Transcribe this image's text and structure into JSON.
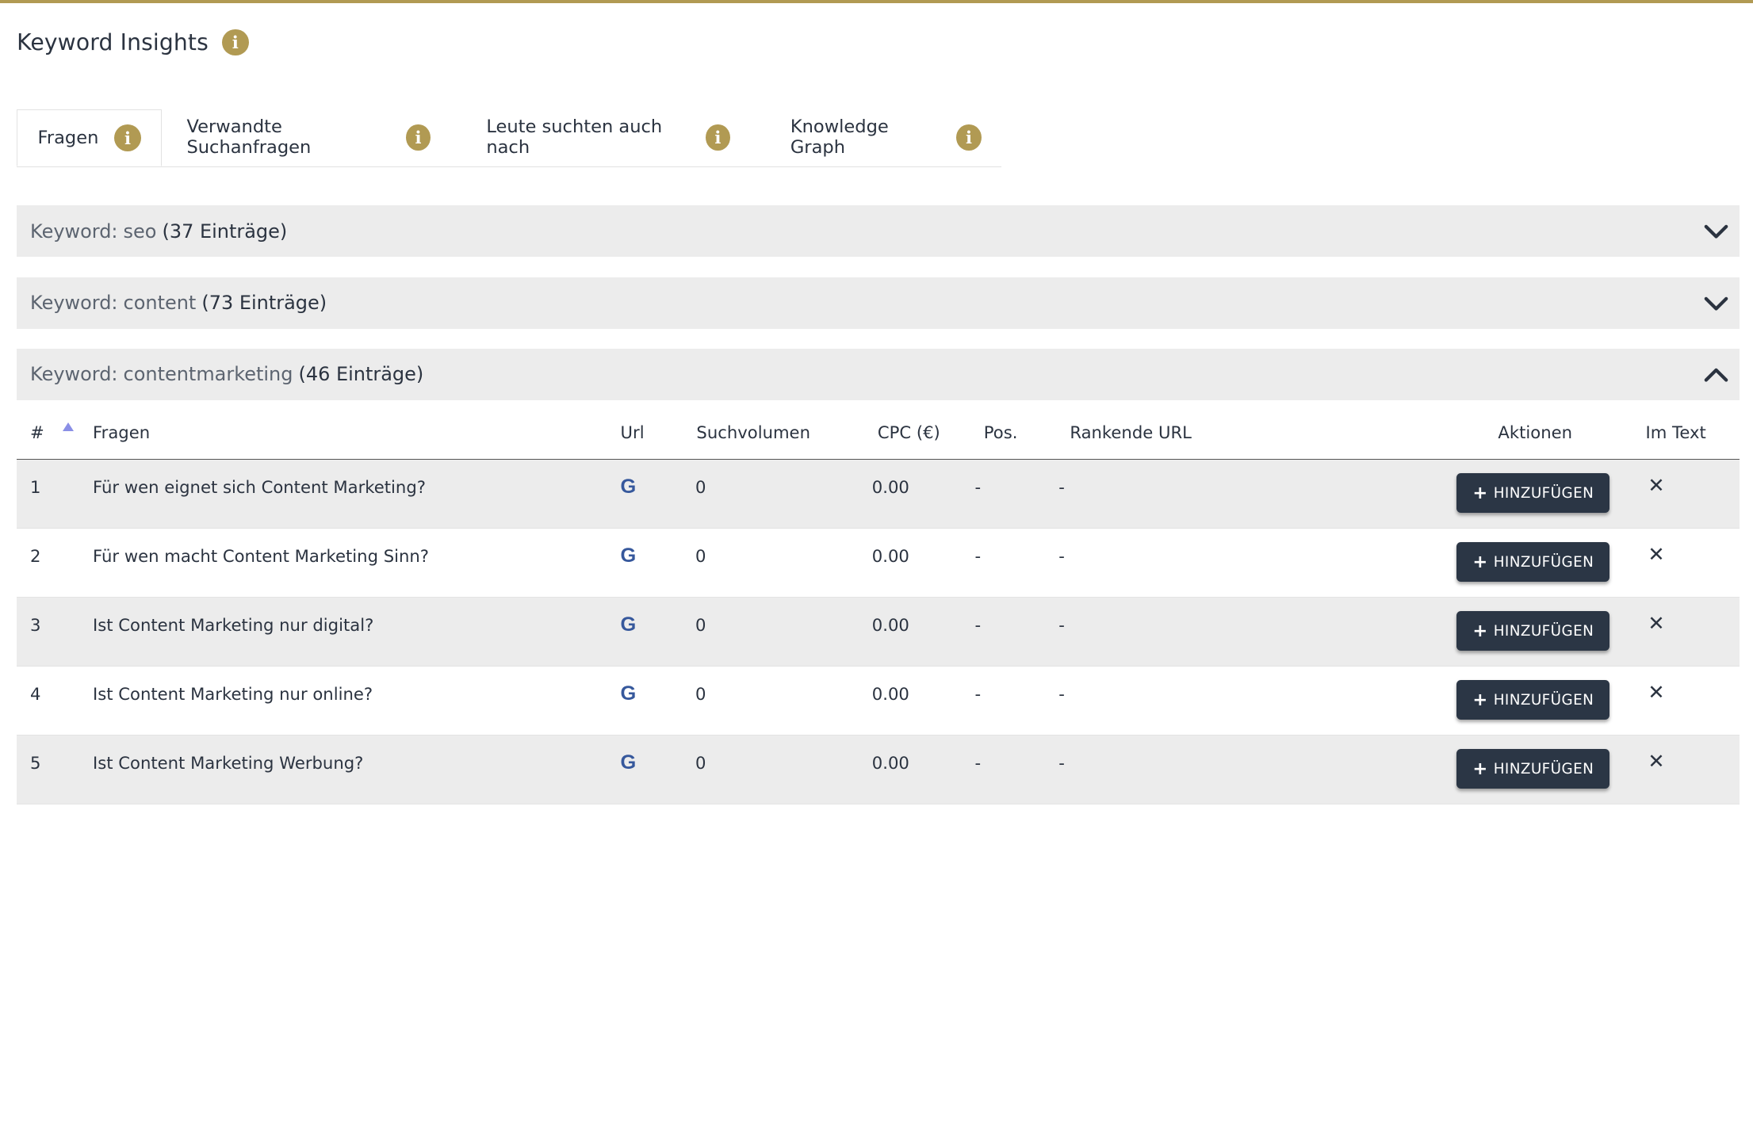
{
  "page": {
    "title": "Keyword Insights",
    "info_icon": "info-icon",
    "accent_color": "#b19a53"
  },
  "tabs": [
    {
      "label": "Fragen",
      "active": true
    },
    {
      "label": "Verwandte Suchanfragen",
      "active": false
    },
    {
      "label": "Leute suchten auch nach",
      "active": false
    },
    {
      "label": "Knowledge Graph",
      "active": false
    }
  ],
  "keywords": [
    {
      "prefix": "Keyword:",
      "name": "seo",
      "count": "(37 Einträge)",
      "expanded": false
    },
    {
      "prefix": "Keyword:",
      "name": "content",
      "count": "(73 Einträge)",
      "expanded": false
    },
    {
      "prefix": "Keyword:",
      "name": "contentmarketing",
      "count": "(46 Einträge)",
      "expanded": true
    }
  ],
  "table": {
    "headers": {
      "num": "#",
      "fragen": "Fragen",
      "url": "Url",
      "suchvolumen": "Suchvolumen",
      "cpc": "CPC (€)",
      "pos": "Pos.",
      "rankende_url": "Rankende URL",
      "aktionen": "Aktionen",
      "im_text": "Im Text"
    },
    "add_label": "HINZUFÜGEN",
    "url_icon": "google-icon",
    "rows": [
      {
        "num": "1",
        "frage": "Für wen eignet sich Content Marketing?",
        "suchvolumen": "0",
        "cpc": "0.00",
        "pos": "-",
        "rankende_url": "-",
        "im_text": "✕"
      },
      {
        "num": "2",
        "frage": "Für wen macht Content Marketing Sinn?",
        "suchvolumen": "0",
        "cpc": "0.00",
        "pos": "-",
        "rankende_url": "-",
        "im_text": "✕"
      },
      {
        "num": "3",
        "frage": "Ist Content Marketing nur digital?",
        "suchvolumen": "0",
        "cpc": "0.00",
        "pos": "-",
        "rankende_url": "-",
        "im_text": "✕"
      },
      {
        "num": "4",
        "frage": "Ist Content Marketing nur online?",
        "suchvolumen": "0",
        "cpc": "0.00",
        "pos": "-",
        "rankende_url": "-",
        "im_text": "✕"
      },
      {
        "num": "5",
        "frage": "Ist Content Marketing Werbung?",
        "suchvolumen": "0",
        "cpc": "0.00",
        "pos": "-",
        "rankende_url": "-",
        "im_text": "✕"
      }
    ]
  }
}
